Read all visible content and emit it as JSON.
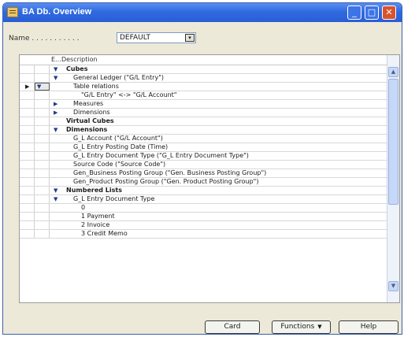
{
  "window": {
    "title": "BA Db. Overview",
    "controls": {
      "minimize": "_",
      "maximize": "□",
      "close": "✕"
    }
  },
  "name": {
    "label": "Name . . . . . . . . . . .",
    "value": "DEFAULT",
    "dropdown_icon": "▾"
  },
  "grid": {
    "headers": {
      "expand": "E...",
      "description": "Description"
    },
    "current_row_marker": "▶",
    "rows": [
      {
        "expand": "▼",
        "description": "Cubes",
        "bold": true
      },
      {
        "expand": "▼",
        "description": "General Ledger (\"G/L Entry\")",
        "bold": false
      },
      {
        "expand": "▼",
        "description": "Table relations",
        "bold": false,
        "current": true
      },
      {
        "expand": "",
        "description": "\"G/L Entry\" <-> \"G/L Account\"",
        "bold": false
      },
      {
        "expand": "▶",
        "description": "Measures",
        "bold": false
      },
      {
        "expand": "▶",
        "description": "Dimensions",
        "bold": false
      },
      {
        "expand": "",
        "description": "Virtual Cubes",
        "bold": true
      },
      {
        "expand": "▼",
        "description": "Dimensions",
        "bold": true
      },
      {
        "expand": "",
        "description": "G_L Account (\"G/L Account\")",
        "bold": false
      },
      {
        "expand": "",
        "description": "G_L Entry Posting Date (Time)",
        "bold": false
      },
      {
        "expand": "",
        "description": "G_L Entry Document Type (\"G_L Entry Document Type\")",
        "bold": false
      },
      {
        "expand": "",
        "description": "Source Code (\"Source Code\")",
        "bold": false
      },
      {
        "expand": "",
        "description": "Gen_Business Posting Group (\"Gen. Business Posting Group\")",
        "bold": false
      },
      {
        "expand": "",
        "description": "Gen_Product Posting Group (\"Gen. Product Posting Group\")",
        "bold": false
      },
      {
        "expand": "▼",
        "description": "Numbered Lists",
        "bold": true
      },
      {
        "expand": "▼",
        "description": "G_L Entry Document Type",
        "bold": false
      },
      {
        "expand": "",
        "description": "0",
        "bold": false
      },
      {
        "expand": "",
        "description": "1 Payment",
        "bold": false
      },
      {
        "expand": "",
        "description": "2 Invoice",
        "bold": false
      },
      {
        "expand": "",
        "description": "3 Credit Memo",
        "bold": false
      }
    ]
  },
  "scrollbar": {
    "up": "▲",
    "down": "▼"
  },
  "buttons": {
    "card": "Card",
    "functions": "Functions",
    "functions_arrow": "▼",
    "help": "Help"
  }
}
